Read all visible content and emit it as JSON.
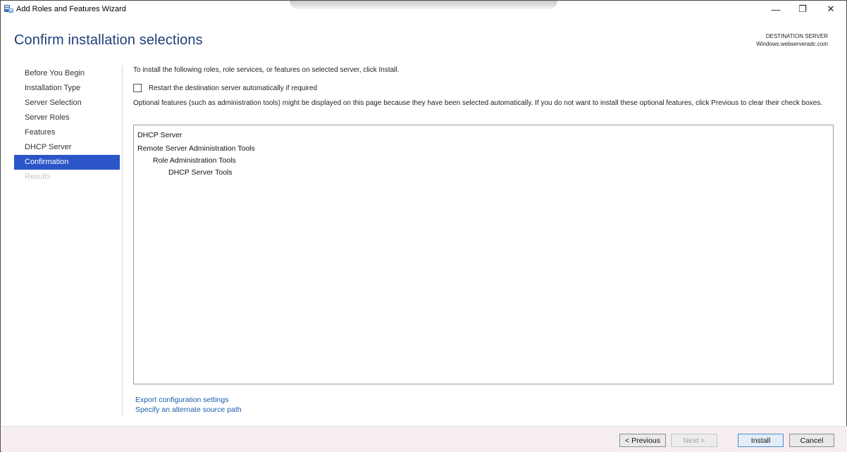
{
  "window": {
    "title": "Add Roles and Features Wizard",
    "controls": {
      "minimize": "—",
      "maximize": "❐",
      "close": "✕"
    }
  },
  "header": {
    "title": "Confirm installation selections",
    "destination_label": "DESTINATION SERVER",
    "destination_server": "Windows.webserveradc.com"
  },
  "nav": {
    "items": [
      {
        "label": "Before You Begin",
        "state": "normal"
      },
      {
        "label": "Installation Type",
        "state": "normal"
      },
      {
        "label": "Server Selection",
        "state": "normal"
      },
      {
        "label": "Server Roles",
        "state": "normal"
      },
      {
        "label": "Features",
        "state": "normal"
      },
      {
        "label": "DHCP Server",
        "state": "normal"
      },
      {
        "label": "Confirmation",
        "state": "active"
      },
      {
        "label": "Results",
        "state": "disabled"
      }
    ]
  },
  "content": {
    "intro": "To install the following roles, role services, or features on selected server, click Install.",
    "restart_label": "Restart the destination server automatically if required",
    "restart_checked": false,
    "optional_text": "Optional features (such as administration tools) might be displayed on this page because they have been selected automatically. If you do not want to install these optional features, click Previous to clear their check boxes.",
    "selections": [
      {
        "label": "DHCP Server",
        "level": 0
      },
      {
        "label": "Remote Server Administration Tools",
        "level": 0
      },
      {
        "label": "Role Administration Tools",
        "level": 1
      },
      {
        "label": "DHCP Server Tools",
        "level": 2
      }
    ],
    "links": {
      "export": "Export configuration settings",
      "alternate_source": "Specify an alternate source path"
    }
  },
  "footer": {
    "previous": "< Previous",
    "next": "Next >",
    "install": "Install",
    "cancel": "Cancel"
  },
  "colors": {
    "title": "#1e3f77",
    "nav_active": "#2b55c8",
    "link": "#1a5dab",
    "footer_bg": "#f5edf0"
  }
}
